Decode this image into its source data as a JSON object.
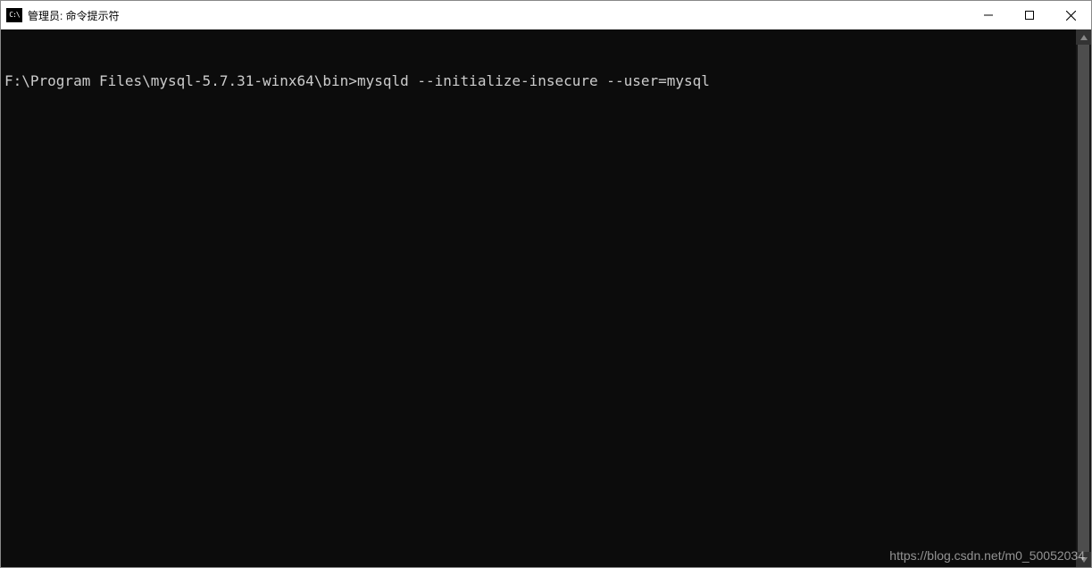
{
  "window": {
    "title": "管理员: 命令提示符",
    "icon_label": "C:\\"
  },
  "terminal": {
    "prompt": "F:\\Program Files\\mysql-5.7.31-winx64\\bin>",
    "command": "mysqld --initialize-insecure --user=mysql"
  },
  "watermark": "https://blog.csdn.net/m0_50052034"
}
